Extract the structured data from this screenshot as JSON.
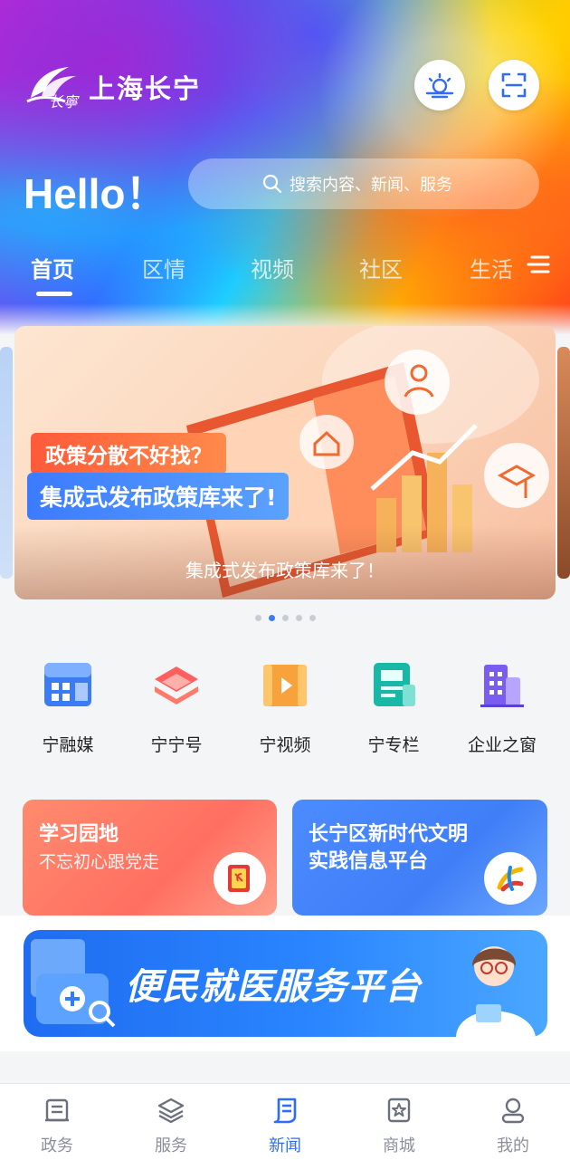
{
  "header": {
    "logo_text": "上海长宁",
    "greeting": "Hello！",
    "search_placeholder": "搜索内容、新闻、服务"
  },
  "tabs": [
    {
      "label": "首页",
      "active": true
    },
    {
      "label": "区情",
      "active": false
    },
    {
      "label": "视频",
      "active": false
    },
    {
      "label": "社区",
      "active": false
    },
    {
      "label": "生活",
      "active": false
    }
  ],
  "banner": {
    "tag_question": "政策分散不好找？",
    "tag_headline": "集成式发布政策库来了!",
    "caption": "集成式发布政策库来了！",
    "page_count": 5,
    "active_page": 2
  },
  "quick_links": [
    {
      "label": "宁融媒",
      "icon": "media-grid-icon"
    },
    {
      "label": "宁宁号",
      "icon": "layers-icon"
    },
    {
      "label": "宁视频",
      "icon": "video-play-icon"
    },
    {
      "label": "宁专栏",
      "icon": "column-doc-icon"
    },
    {
      "label": "企业之窗",
      "icon": "building-icon"
    }
  ],
  "cards": {
    "study": {
      "title": "学习园地",
      "subtitle": "不忘初心跟党走"
    },
    "civilization": {
      "title": "长宁区新时代文明",
      "subtitle": "实践信息平台"
    }
  },
  "medical_banner": {
    "text": "便民就医服务平台"
  },
  "bottom_nav": [
    {
      "label": "政务",
      "active": false
    },
    {
      "label": "服务",
      "active": false
    },
    {
      "label": "新闻",
      "active": true
    },
    {
      "label": "商城",
      "active": false
    },
    {
      "label": "我的",
      "active": false
    }
  ],
  "colors": {
    "accent": "#2f6df5",
    "inactive": "#8a8f99",
    "study_card": "#ff7a68",
    "civilization_card": "#4a8cff"
  }
}
